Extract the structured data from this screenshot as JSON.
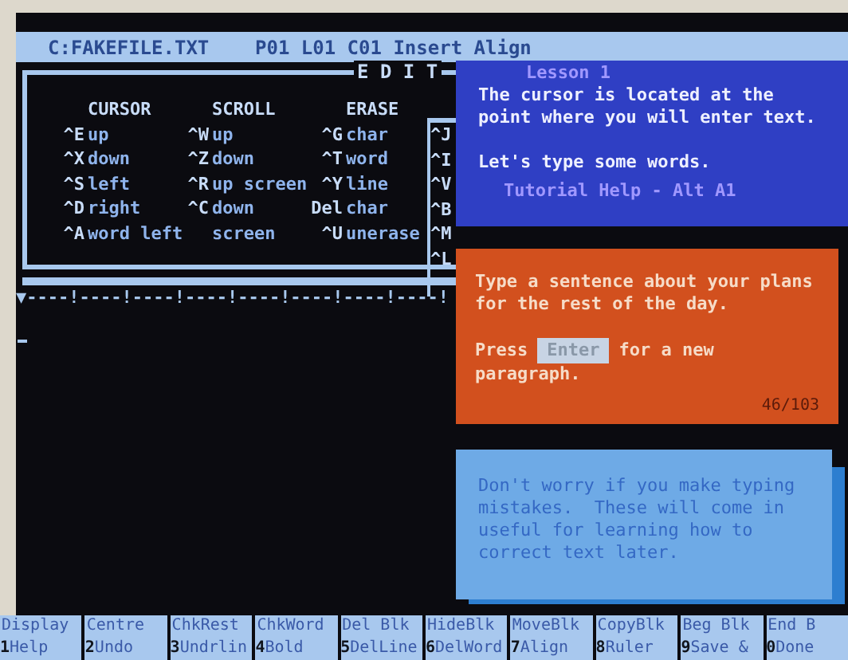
{
  "title_bar": {
    "file": "C:FAKEFILE.TXT",
    "status": "P01 L01 C01 Insert Align"
  },
  "edit_menu": {
    "title": "E D I T",
    "sections": [
      {
        "heading": "CURSOR",
        "items": [
          {
            "key": "^E",
            "label": "up"
          },
          {
            "key": "^X",
            "label": "down"
          },
          {
            "key": "^S",
            "label": "left"
          },
          {
            "key": "^D",
            "label": "right"
          },
          {
            "key": "^A",
            "label": "word left"
          }
        ]
      },
      {
        "heading": "SCROLL",
        "items": [
          {
            "key": "^W",
            "label": "up"
          },
          {
            "key": "^Z",
            "label": "down"
          },
          {
            "key": "^R",
            "label": "up screen"
          },
          {
            "key": "^C",
            "label": "down"
          },
          {
            "label": "screen"
          }
        ]
      },
      {
        "heading": "ERASE",
        "items": [
          {
            "key": "^G",
            "label": "char"
          },
          {
            "key": "^T",
            "label": "word"
          },
          {
            "key": "^Y",
            "label": "line"
          },
          {
            "key": "Del",
            "label": "char"
          },
          {
            "key": "^U",
            "label": "unerase"
          }
        ]
      }
    ],
    "side_keys": [
      "^J",
      "^I",
      "^V",
      "^B",
      "^M",
      "^L"
    ]
  },
  "ruler": "▼----!----!----!----!----!----!----!----!",
  "lesson_panel": {
    "heading": "Lesson 1",
    "paragraphs": [
      [
        "The cursor is located at the",
        "point where you will enter text."
      ],
      [
        "Let's type some words."
      ]
    ],
    "footer": "Tutorial Help - Alt A1"
  },
  "task_panel": {
    "lines": [
      "Type a sentence about your plans",
      "for the rest of the day."
    ],
    "press": "Press",
    "key": "Enter",
    "after": "for a new",
    "last": "paragraph.",
    "counter": "46/103"
  },
  "note_panel": {
    "lines": [
      "Don't worry if you make typing",
      "mistakes.  These will come in",
      "useful for learning how to",
      "correct text later."
    ]
  },
  "function_keys": [
    {
      "top": "Display",
      "number": "1",
      "bottom": "Help"
    },
    {
      "top": "Centre",
      "number": "2",
      "bottom": "Undo"
    },
    {
      "top": "ChkRest",
      "number": "3",
      "bottom": "Undrlin"
    },
    {
      "top": "ChkWord",
      "number": "4",
      "bottom": "Bold"
    },
    {
      "top": "Del Blk",
      "number": "5",
      "bottom": "DelLine"
    },
    {
      "top": "HideBlk",
      "number": "6",
      "bottom": "DelWord"
    },
    {
      "top": "MoveBlk",
      "number": "7",
      "bottom": "Align"
    },
    {
      "top": "CopyBlk",
      "number": "8",
      "bottom": "Ruler"
    },
    {
      "top": "Beg Blk",
      "number": "9",
      "bottom": "Save &"
    },
    {
      "top": "End B",
      "number": "0",
      "bottom": "Done"
    }
  ]
}
